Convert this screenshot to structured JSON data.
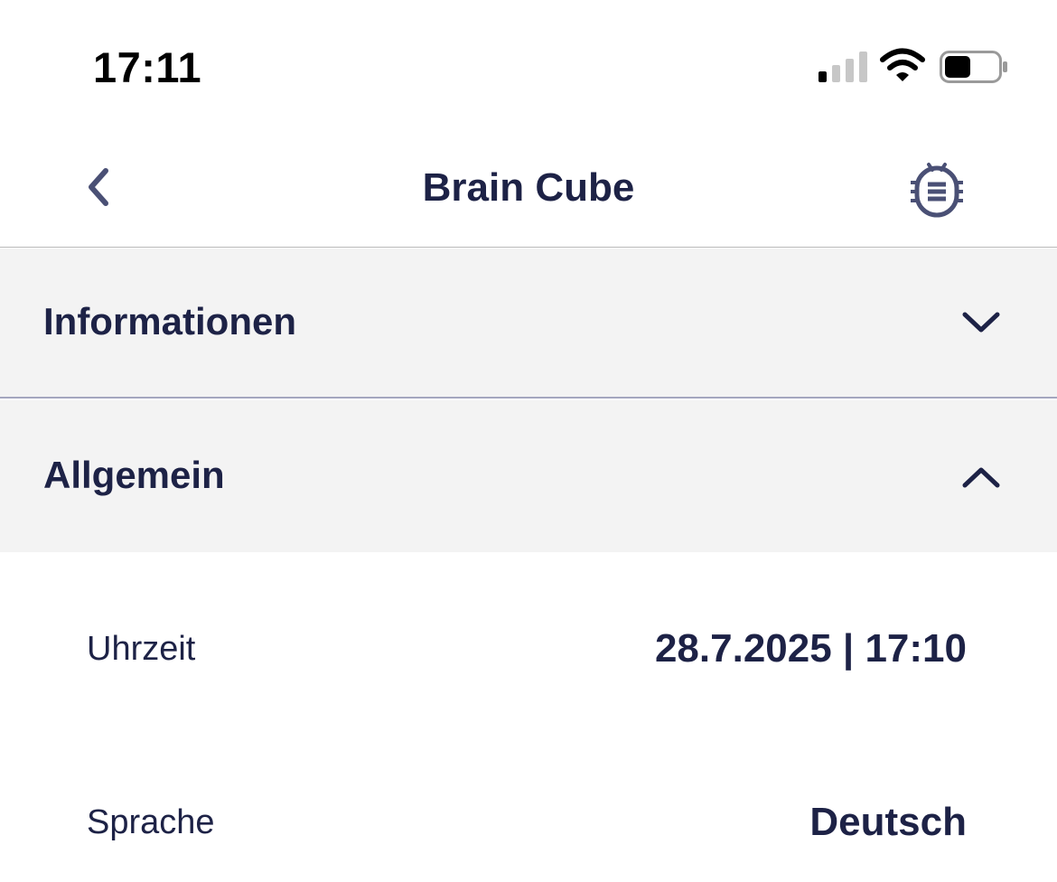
{
  "status_bar": {
    "time": "17:11",
    "signal_icon": "cellular-signal-icon",
    "wifi_icon": "wifi-icon",
    "battery_icon": "battery-icon",
    "battery_level": 0.45
  },
  "nav": {
    "title": "Brain Cube",
    "back_icon": "chevron-left-icon",
    "action_icon": "bug-icon"
  },
  "sections": [
    {
      "title": "Informationen",
      "expanded": false,
      "icon": "chevron-down-icon"
    },
    {
      "title": "Allgemein",
      "expanded": true,
      "icon": "chevron-up-icon"
    }
  ],
  "general": {
    "rows": [
      {
        "label": "Uhrzeit",
        "value": "28.7.2025 | 17:10"
      },
      {
        "label": "Sprache",
        "value": "Deutsch"
      }
    ]
  },
  "colors": {
    "text_primary": "#1d2246",
    "section_background": "#f3f3f3",
    "section_divider": "#a4a6be",
    "icon_gray": "#4a5075"
  }
}
